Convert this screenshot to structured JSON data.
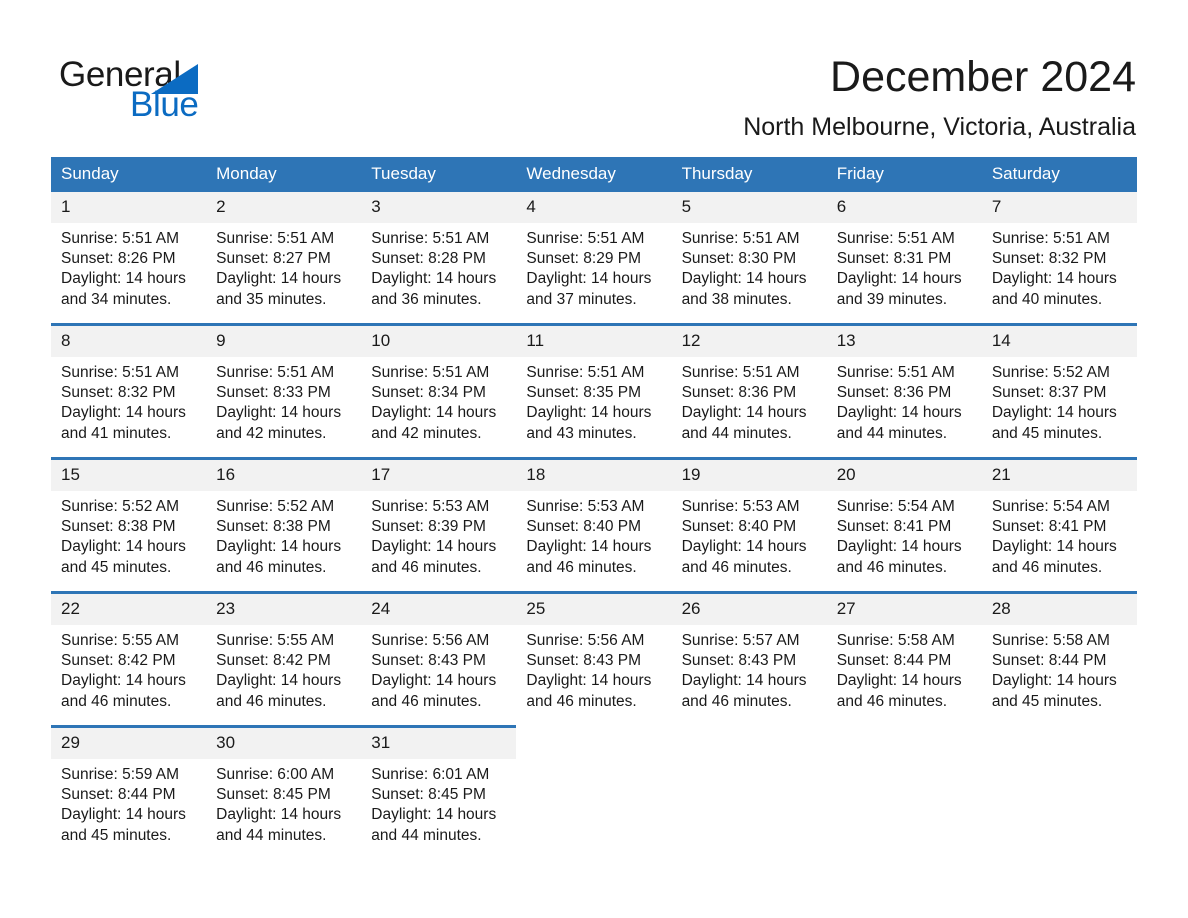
{
  "brand": {
    "word_general": "General",
    "word_blue": "Blue",
    "logo_icon": "triangle-logo-icon",
    "accent_color": "#0b6bc2"
  },
  "header": {
    "title": "December 2024",
    "subtitle": "North Melbourne, Victoria, Australia"
  },
  "calendar": {
    "header_color": "#2e75b6",
    "daynum_band_color": "#f2f2f2",
    "weekday_headers": [
      "Sunday",
      "Monday",
      "Tuesday",
      "Wednesday",
      "Thursday",
      "Friday",
      "Saturday"
    ],
    "labels": {
      "sunrise": "Sunrise:",
      "sunset": "Sunset:",
      "daylight": "Daylight:"
    },
    "weeks": [
      [
        {
          "day": "1",
          "sunrise": "Sunrise: 5:51 AM",
          "sunset": "Sunset: 8:26 PM",
          "daylight_1": "Daylight: 14 hours",
          "daylight_2": "and 34 minutes."
        },
        {
          "day": "2",
          "sunrise": "Sunrise: 5:51 AM",
          "sunset": "Sunset: 8:27 PM",
          "daylight_1": "Daylight: 14 hours",
          "daylight_2": "and 35 minutes."
        },
        {
          "day": "3",
          "sunrise": "Sunrise: 5:51 AM",
          "sunset": "Sunset: 8:28 PM",
          "daylight_1": "Daylight: 14 hours",
          "daylight_2": "and 36 minutes."
        },
        {
          "day": "4",
          "sunrise": "Sunrise: 5:51 AM",
          "sunset": "Sunset: 8:29 PM",
          "daylight_1": "Daylight: 14 hours",
          "daylight_2": "and 37 minutes."
        },
        {
          "day": "5",
          "sunrise": "Sunrise: 5:51 AM",
          "sunset": "Sunset: 8:30 PM",
          "daylight_1": "Daylight: 14 hours",
          "daylight_2": "and 38 minutes."
        },
        {
          "day": "6",
          "sunrise": "Sunrise: 5:51 AM",
          "sunset": "Sunset: 8:31 PM",
          "daylight_1": "Daylight: 14 hours",
          "daylight_2": "and 39 minutes."
        },
        {
          "day": "7",
          "sunrise": "Sunrise: 5:51 AM",
          "sunset": "Sunset: 8:32 PM",
          "daylight_1": "Daylight: 14 hours",
          "daylight_2": "and 40 minutes."
        }
      ],
      [
        {
          "day": "8",
          "sunrise": "Sunrise: 5:51 AM",
          "sunset": "Sunset: 8:32 PM",
          "daylight_1": "Daylight: 14 hours",
          "daylight_2": "and 41 minutes."
        },
        {
          "day": "9",
          "sunrise": "Sunrise: 5:51 AM",
          "sunset": "Sunset: 8:33 PM",
          "daylight_1": "Daylight: 14 hours",
          "daylight_2": "and 42 minutes."
        },
        {
          "day": "10",
          "sunrise": "Sunrise: 5:51 AM",
          "sunset": "Sunset: 8:34 PM",
          "daylight_1": "Daylight: 14 hours",
          "daylight_2": "and 42 minutes."
        },
        {
          "day": "11",
          "sunrise": "Sunrise: 5:51 AM",
          "sunset": "Sunset: 8:35 PM",
          "daylight_1": "Daylight: 14 hours",
          "daylight_2": "and 43 minutes."
        },
        {
          "day": "12",
          "sunrise": "Sunrise: 5:51 AM",
          "sunset": "Sunset: 8:36 PM",
          "daylight_1": "Daylight: 14 hours",
          "daylight_2": "and 44 minutes."
        },
        {
          "day": "13",
          "sunrise": "Sunrise: 5:51 AM",
          "sunset": "Sunset: 8:36 PM",
          "daylight_1": "Daylight: 14 hours",
          "daylight_2": "and 44 minutes."
        },
        {
          "day": "14",
          "sunrise": "Sunrise: 5:52 AM",
          "sunset": "Sunset: 8:37 PM",
          "daylight_1": "Daylight: 14 hours",
          "daylight_2": "and 45 minutes."
        }
      ],
      [
        {
          "day": "15",
          "sunrise": "Sunrise: 5:52 AM",
          "sunset": "Sunset: 8:38 PM",
          "daylight_1": "Daylight: 14 hours",
          "daylight_2": "and 45 minutes."
        },
        {
          "day": "16",
          "sunrise": "Sunrise: 5:52 AM",
          "sunset": "Sunset: 8:38 PM",
          "daylight_1": "Daylight: 14 hours",
          "daylight_2": "and 46 minutes."
        },
        {
          "day": "17",
          "sunrise": "Sunrise: 5:53 AM",
          "sunset": "Sunset: 8:39 PM",
          "daylight_1": "Daylight: 14 hours",
          "daylight_2": "and 46 minutes."
        },
        {
          "day": "18",
          "sunrise": "Sunrise: 5:53 AM",
          "sunset": "Sunset: 8:40 PM",
          "daylight_1": "Daylight: 14 hours",
          "daylight_2": "and 46 minutes."
        },
        {
          "day": "19",
          "sunrise": "Sunrise: 5:53 AM",
          "sunset": "Sunset: 8:40 PM",
          "daylight_1": "Daylight: 14 hours",
          "daylight_2": "and 46 minutes."
        },
        {
          "day": "20",
          "sunrise": "Sunrise: 5:54 AM",
          "sunset": "Sunset: 8:41 PM",
          "daylight_1": "Daylight: 14 hours",
          "daylight_2": "and 46 minutes."
        },
        {
          "day": "21",
          "sunrise": "Sunrise: 5:54 AM",
          "sunset": "Sunset: 8:41 PM",
          "daylight_1": "Daylight: 14 hours",
          "daylight_2": "and 46 minutes."
        }
      ],
      [
        {
          "day": "22",
          "sunrise": "Sunrise: 5:55 AM",
          "sunset": "Sunset: 8:42 PM",
          "daylight_1": "Daylight: 14 hours",
          "daylight_2": "and 46 minutes."
        },
        {
          "day": "23",
          "sunrise": "Sunrise: 5:55 AM",
          "sunset": "Sunset: 8:42 PM",
          "daylight_1": "Daylight: 14 hours",
          "daylight_2": "and 46 minutes."
        },
        {
          "day": "24",
          "sunrise": "Sunrise: 5:56 AM",
          "sunset": "Sunset: 8:43 PM",
          "daylight_1": "Daylight: 14 hours",
          "daylight_2": "and 46 minutes."
        },
        {
          "day": "25",
          "sunrise": "Sunrise: 5:56 AM",
          "sunset": "Sunset: 8:43 PM",
          "daylight_1": "Daylight: 14 hours",
          "daylight_2": "and 46 minutes."
        },
        {
          "day": "26",
          "sunrise": "Sunrise: 5:57 AM",
          "sunset": "Sunset: 8:43 PM",
          "daylight_1": "Daylight: 14 hours",
          "daylight_2": "and 46 minutes."
        },
        {
          "day": "27",
          "sunrise": "Sunrise: 5:58 AM",
          "sunset": "Sunset: 8:44 PM",
          "daylight_1": "Daylight: 14 hours",
          "daylight_2": "and 46 minutes."
        },
        {
          "day": "28",
          "sunrise": "Sunrise: 5:58 AM",
          "sunset": "Sunset: 8:44 PM",
          "daylight_1": "Daylight: 14 hours",
          "daylight_2": "and 45 minutes."
        }
      ],
      [
        {
          "day": "29",
          "sunrise": "Sunrise: 5:59 AM",
          "sunset": "Sunset: 8:44 PM",
          "daylight_1": "Daylight: 14 hours",
          "daylight_2": "and 45 minutes."
        },
        {
          "day": "30",
          "sunrise": "Sunrise: 6:00 AM",
          "sunset": "Sunset: 8:45 PM",
          "daylight_1": "Daylight: 14 hours",
          "daylight_2": "and 44 minutes."
        },
        {
          "day": "31",
          "sunrise": "Sunrise: 6:01 AM",
          "sunset": "Sunset: 8:45 PM",
          "daylight_1": "Daylight: 14 hours",
          "daylight_2": "and 44 minutes."
        },
        {
          "day": "",
          "sunrise": "",
          "sunset": "",
          "daylight_1": "",
          "daylight_2": ""
        },
        {
          "day": "",
          "sunrise": "",
          "sunset": "",
          "daylight_1": "",
          "daylight_2": ""
        },
        {
          "day": "",
          "sunrise": "",
          "sunset": "",
          "daylight_1": "",
          "daylight_2": ""
        },
        {
          "day": "",
          "sunrise": "",
          "sunset": "",
          "daylight_1": "",
          "daylight_2": ""
        }
      ]
    ]
  }
}
